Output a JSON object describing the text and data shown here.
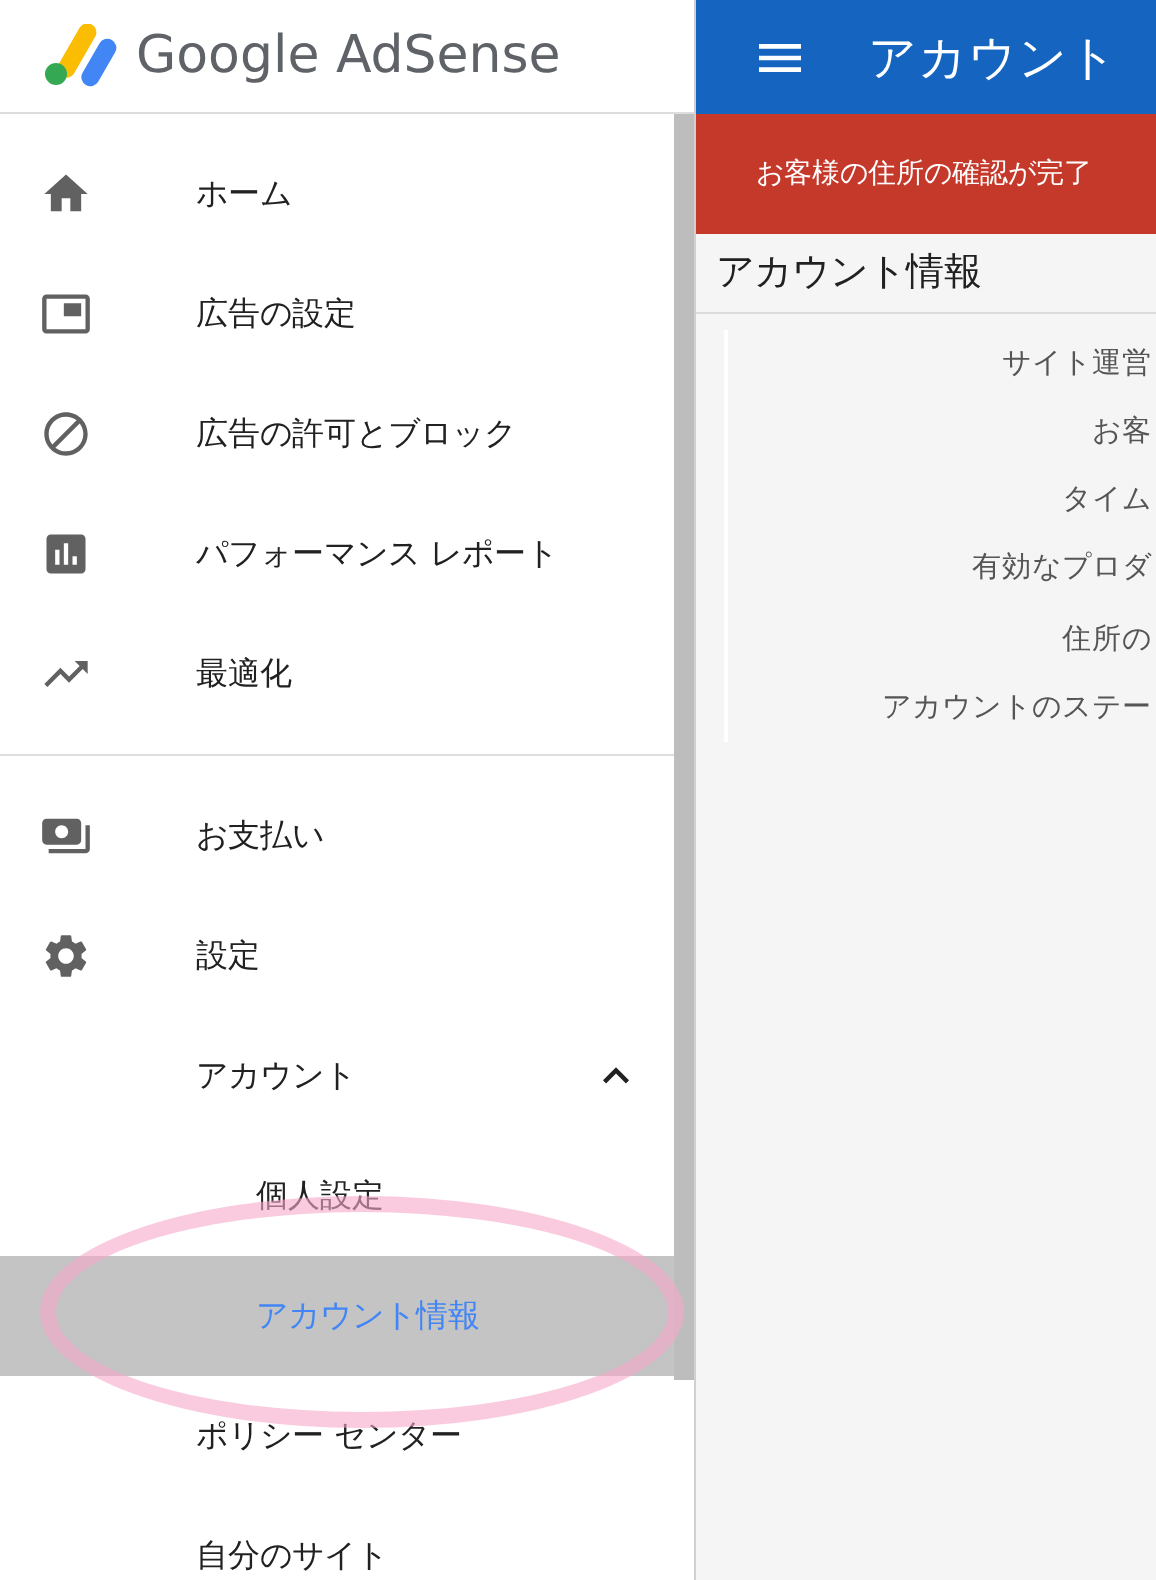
{
  "logo": {
    "text": "Google AdSense"
  },
  "sidebar": {
    "sections": [
      {
        "items": [
          {
            "label": "ホーム",
            "kind": "home",
            "selected": false
          },
          {
            "label": "広告の設定",
            "kind": "ad",
            "selected": false
          },
          {
            "label": "広告の許可とブロック",
            "kind": "block",
            "selected": false
          },
          {
            "label": "パフォーマンス レポート",
            "kind": "report",
            "selected": false
          },
          {
            "label": "最適化",
            "kind": "trend",
            "selected": false
          }
        ]
      },
      {
        "items": [
          {
            "label": "お支払い",
            "kind": "payments",
            "selected": false
          },
          {
            "label": "設定",
            "kind": "settings",
            "selected": false
          },
          {
            "label": "アカウント",
            "kind": "group",
            "selected": false,
            "expanded": true,
            "children": [
              {
                "label": "個人設定",
                "selected": false
              },
              {
                "label": "アカウント情報",
                "selected": true
              }
            ]
          },
          {
            "label": "ポリシー センター",
            "kind": "text",
            "selected": false
          },
          {
            "label": "自分のサイト",
            "kind": "text",
            "selected": false
          }
        ]
      }
    ]
  },
  "header": {
    "title": "アカウント"
  },
  "banner": {
    "text": "お客様の住所の確認が完了"
  },
  "content": {
    "heading": "アカウント情報",
    "row_groups": [
      [
        "サイト運営",
        "お客",
        "タイム",
        "有効なプロダ"
      ],
      [
        "住所の",
        "アカウントのステー"
      ]
    ]
  }
}
